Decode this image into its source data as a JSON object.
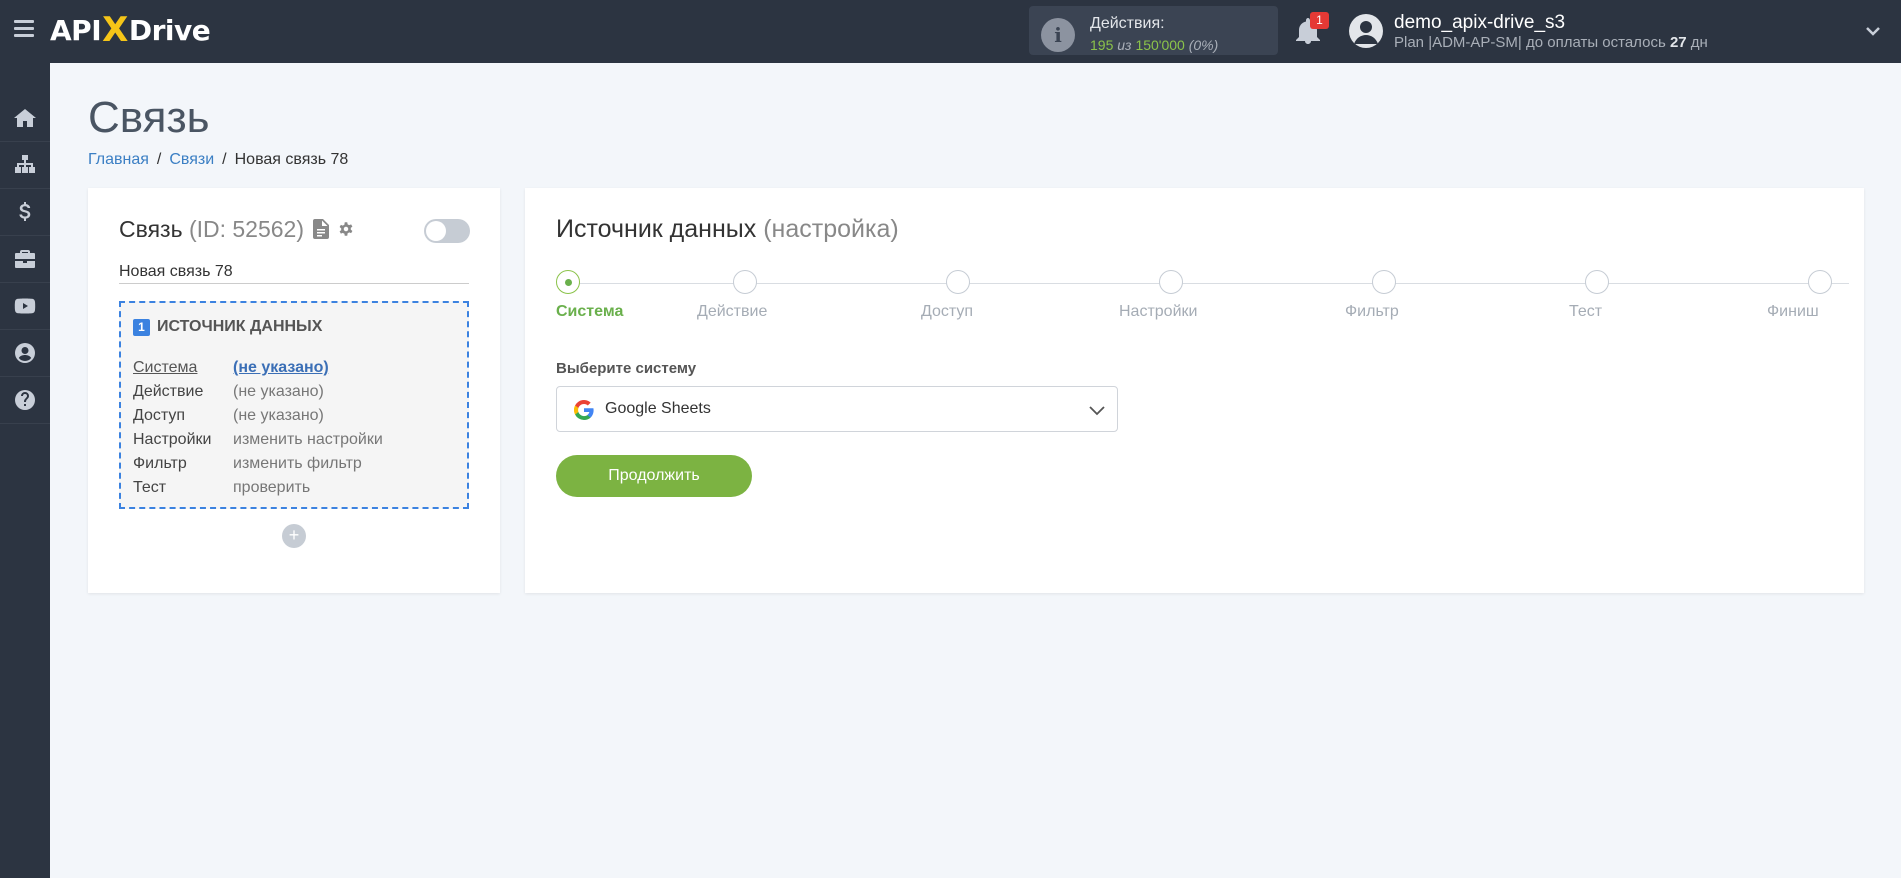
{
  "header": {
    "logo_text_1": "API",
    "logo_x": "X",
    "logo_text_2": "Drive",
    "actions_label": "Действия:",
    "actions_used": "195",
    "actions_sep": "из",
    "actions_total": "150'000",
    "actions_pct": "(0%)",
    "notifications_count": "1",
    "user_name": "demo_apix-drive_s3",
    "plan_prefix": "Plan |ADM-AP-SM| до оплаты осталось",
    "plan_days": "27",
    "plan_days_unit": "дн"
  },
  "sidebar": {
    "items": [
      {
        "icon": "home-icon"
      },
      {
        "icon": "sitemap-icon"
      },
      {
        "icon": "dollar-icon"
      },
      {
        "icon": "briefcase-icon"
      },
      {
        "icon": "youtube-icon"
      },
      {
        "icon": "user-icon"
      },
      {
        "icon": "help-icon"
      }
    ]
  },
  "page": {
    "title": "Связь",
    "breadcrumb": {
      "home": "Главная",
      "links": "Связи",
      "current": "Новая связь 78"
    }
  },
  "connection": {
    "title": "Связь",
    "id_text": "(ID: 52562)",
    "name_value": "Новая связь 78",
    "source": {
      "number": "1",
      "title": "ИСТОЧНИК ДАННЫХ",
      "rows": [
        {
          "key": "Система",
          "value": "(не указано)"
        },
        {
          "key": "Действие",
          "value": "(не указано)"
        },
        {
          "key": "Доступ",
          "value": "(не указано)"
        },
        {
          "key": "Настройки",
          "value": "изменить настройки"
        },
        {
          "key": "Фильтр",
          "value": "изменить фильтр"
        },
        {
          "key": "Тест",
          "value": "проверить"
        }
      ]
    },
    "add_label": "+"
  },
  "setup": {
    "title": "Источник данных",
    "subtitle": "(настройка)",
    "steps": [
      "Система",
      "Действие",
      "Доступ",
      "Настройки",
      "Фильтр",
      "Тест",
      "Финиш"
    ],
    "active_step": 0,
    "select_label": "Выберите систему",
    "select_value": "Google Sheets",
    "continue_label": "Продолжить"
  },
  "colors": {
    "topbar": "#2c3441",
    "accent_green": "#7cb342",
    "link_blue": "#3b7fc4",
    "dashed_border": "#3b82e0"
  }
}
